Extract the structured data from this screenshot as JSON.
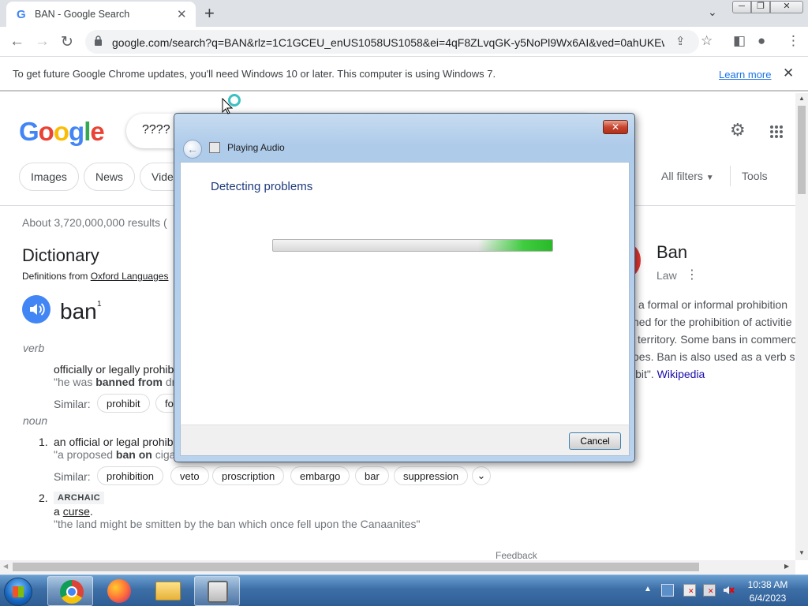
{
  "browser": {
    "tab_title": "BAN - Google Search",
    "tab_favicon": "G",
    "new_tab": "+",
    "url": "google.com/search?q=BAN&rlz=1C1GCEU_enUS1058US1058&ei=4qF8ZLvqGK-y5NoPl9Wx6AI&ved=0ahUKEwi...",
    "infobar_message": "To get future Google Chrome updates, you'll need Windows 10 or later. This computer is using Windows 7.",
    "infobar_link": "Learn more"
  },
  "google": {
    "search_query": "????",
    "tabs": [
      "Images",
      "News",
      "Vide"
    ],
    "all_filters": "All filters",
    "tools": "Tools",
    "results_count": "About 3,720,000,000 results (",
    "dictionary_title": "Dictionary",
    "dictionary_source_prefix": "Definitions from",
    "dictionary_source": "Oxford Languages",
    "word": "ban",
    "word_sup": "1",
    "verb_label": "verb",
    "verb_def": "officially or legally prohib",
    "verb_ex_1": "\"he was ",
    "verb_ex_bold": "banned from",
    "verb_ex_2": " dri",
    "similar_label": "Similar:",
    "verb_similar": [
      "prohibit",
      "fo"
    ],
    "noun_label": "noun",
    "noun_def1_num": "1.",
    "noun_def1": "an official or legal prohib",
    "noun_ex1_1": "\"a proposed ",
    "noun_ex1_bold": "ban on",
    "noun_ex1_2": " ciga",
    "noun_similar": [
      "prohibition",
      "veto",
      "proscription",
      "embargo",
      "bar",
      "suppression"
    ],
    "noun_def2_num": "2.",
    "archaic": "ARCHAIC",
    "noun_def2_a": "a ",
    "noun_def2_link": "curse",
    "noun_def2_end": ".",
    "noun_ex2": "\"the land might be smitten by the ban which once fell upon the Canaanites\"",
    "feedback": "Feedback"
  },
  "knowledge_panel": {
    "title": "Ban",
    "subtitle": "Law",
    "lines": [
      "a formal or informal prohibition",
      "ned for the prohibition of activitie",
      "territory. Some bans in commerc",
      "oes. Ban is also used as a verb si"
    ],
    "last_line_prefix": "ibit\". ",
    "wikipedia": "Wikipedia"
  },
  "dialog": {
    "title": "Playing Audio",
    "heading": "Detecting problems",
    "cancel": "Cancel",
    "close": "✕",
    "progress_state": "indeterminate"
  },
  "taskbar": {
    "time": "10:38 AM",
    "date": "6/4/2023"
  },
  "colors": {
    "google_blue": "#4285f4",
    "google_red": "#ea4335",
    "google_yellow": "#fbbc05",
    "google_green": "#34a853",
    "dialog_heading": "#1e3a7b"
  }
}
